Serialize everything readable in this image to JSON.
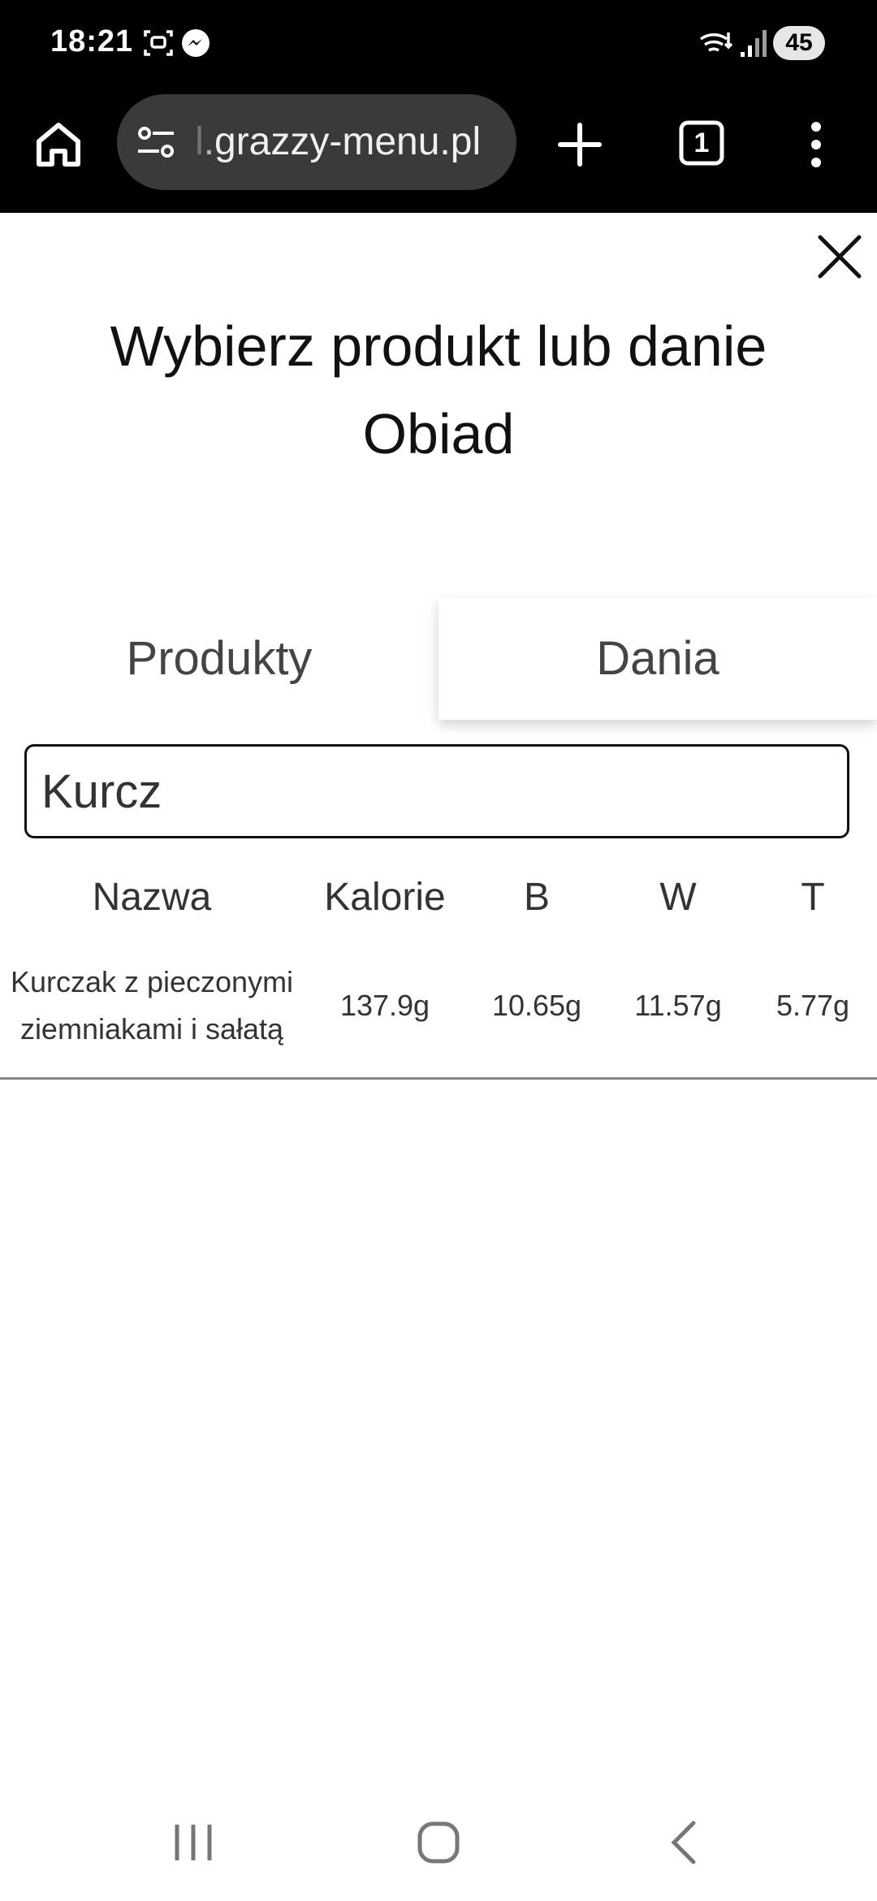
{
  "status_bar": {
    "time": "18:21",
    "battery": "45",
    "icons": [
      "screenshot-icon",
      "messenger-icon",
      "wifi-icon",
      "signal-icon"
    ]
  },
  "browser": {
    "url": "l.grazzy-menu.pl",
    "icons": [
      "home-icon",
      "site-settings-icon",
      "new-tab-icon",
      "tabs-icon",
      "more-icon"
    ],
    "tab_count": "1"
  },
  "dialog": {
    "title_line1": "Wybierz produkt lub danie",
    "title_line2": "Obiad",
    "tabs": [
      {
        "label": "Produkty",
        "active": false
      },
      {
        "label": "Dania",
        "active": true
      }
    ],
    "search": {
      "value": "Kurcz",
      "placeholder": ""
    }
  },
  "table": {
    "columns": [
      "Nazwa",
      "Kalorie",
      "B",
      "W",
      "T"
    ],
    "rows": [
      {
        "name": "Kurczak z pieczonymi ziemniakami i sałatą",
        "kalorie": "137.9g",
        "b": "10.65g",
        "w": "11.57g",
        "t": "5.77g"
      }
    ]
  },
  "nav_bar": {
    "icons": [
      "recent-apps-icon",
      "home-nav-icon",
      "back-icon"
    ]
  }
}
